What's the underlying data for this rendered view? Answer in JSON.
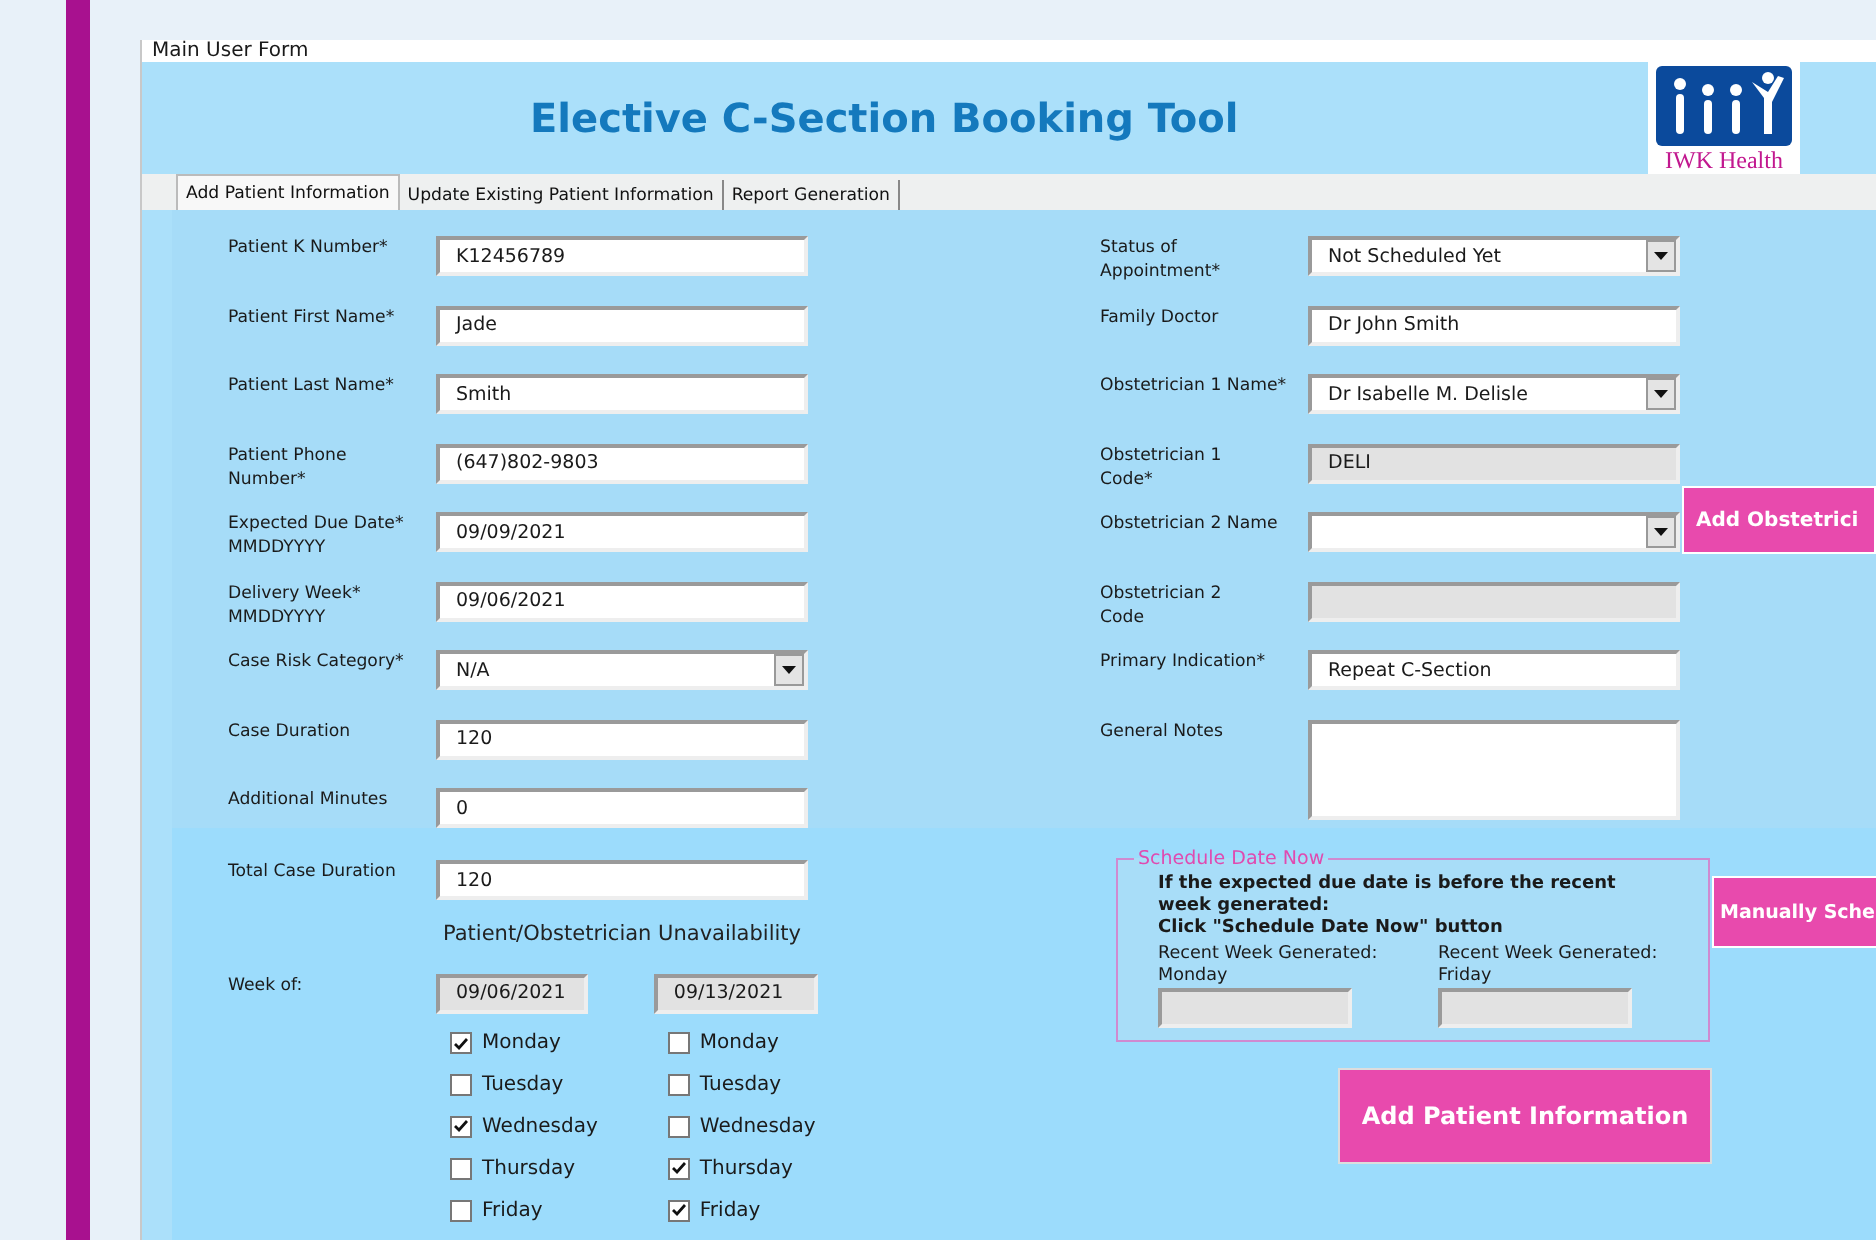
{
  "window": {
    "title": "Main User Form"
  },
  "header": {
    "title": "Elective C-Section Booking Tool",
    "logo_text": "IWK Health"
  },
  "tabs": [
    {
      "label": "Add Patient Information",
      "selected": true
    },
    {
      "label": "Update Existing Patient Information",
      "selected": false
    },
    {
      "label": "Report Generation",
      "selected": false
    }
  ],
  "left_fields": [
    {
      "label": "Patient K Number*",
      "kind": "text",
      "value": "K12456789"
    },
    {
      "label": "Patient First Name*",
      "kind": "text",
      "value": "Jade"
    },
    {
      "label": "Patient Last Name*",
      "kind": "text",
      "value": "Smith"
    },
    {
      "label": "Patient Phone\nNumber*",
      "kind": "text",
      "value": "(647)802-9803"
    },
    {
      "label": "Expected Due Date*\nMMDDYYYY",
      "kind": "text",
      "value": "09/09/2021"
    },
    {
      "label": "Delivery Week*\nMMDDYYYY",
      "kind": "text",
      "value": "09/06/2021"
    },
    {
      "label": "Case Risk Category*",
      "kind": "dropdown",
      "value": "N/A"
    },
    {
      "label": "Case Duration",
      "kind": "text",
      "value": "120"
    },
    {
      "label": "Additional Minutes",
      "kind": "text",
      "value": "0"
    }
  ],
  "right_fields": [
    {
      "label": "Status of\nAppointment*",
      "kind": "dropdown",
      "value": "Not Scheduled Yet"
    },
    {
      "label": "Family Doctor",
      "kind": "text",
      "value": "Dr John Smith"
    },
    {
      "label": "Obstetrician 1 Name*",
      "kind": "dropdown",
      "value": "Dr Isabelle M. Delisle"
    },
    {
      "label": "Obstetrician 1\nCode*",
      "kind": "readonly",
      "value": "DELI"
    },
    {
      "label": "Obstetrician 2 Name",
      "kind": "dropdown",
      "side_button": "Add Obstetrici"
    },
    {
      "label": "Obstetrician 2\nCode",
      "kind": "readonly"
    },
    {
      "label": "Primary Indication*",
      "kind": "text",
      "value": "Repeat C-Section"
    },
    {
      "label": "General Notes",
      "kind": "textarea"
    }
  ],
  "total_duration": {
    "label": "Total Case Duration",
    "value": "120"
  },
  "unavailability": {
    "title": "Patient/Obstetrician Unavailability",
    "week_label": "Week of:",
    "weeks": [
      {
        "date": "09/06/2021",
        "days": [
          {
            "label": "Monday",
            "checked": true
          },
          {
            "label": "Tuesday",
            "checked": false
          },
          {
            "label": "Wednesday",
            "checked": true
          },
          {
            "label": "Thursday",
            "checked": false
          },
          {
            "label": "Friday",
            "checked": false
          }
        ]
      },
      {
        "date": "09/13/2021",
        "days": [
          {
            "label": "Monday",
            "checked": false
          },
          {
            "label": "Tuesday",
            "checked": false
          },
          {
            "label": "Wednesday",
            "checked": false
          },
          {
            "label": "Thursday",
            "checked": true
          },
          {
            "label": "Friday",
            "checked": true
          }
        ]
      }
    ]
  },
  "schedule_box": {
    "legend": "Schedule Date Now",
    "instructions": "If the expected due date is before the recent week generated:\nClick \"Schedule Date Now\" button",
    "fields": [
      {
        "label": "Recent Week Generated:\nMonday"
      },
      {
        "label": "Recent Week Generated:\nFriday"
      }
    ]
  },
  "manual_button": "Manually Sche",
  "submit_button": "Add Patient Information"
}
